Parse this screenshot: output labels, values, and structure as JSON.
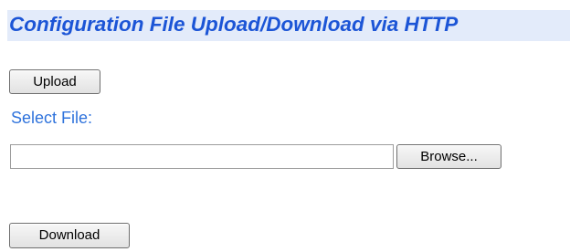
{
  "page": {
    "title": "Configuration File Upload/Download via HTTP"
  },
  "upload": {
    "button_label": "Upload"
  },
  "file_select": {
    "label": "Select File:",
    "value": "",
    "placeholder": "",
    "browse_label": "Browse..."
  },
  "download": {
    "button_label": "Download"
  },
  "colors": {
    "title_text": "#1c55d6",
    "title_background": "#e3ebfa",
    "label_text": "#2f73dc"
  }
}
